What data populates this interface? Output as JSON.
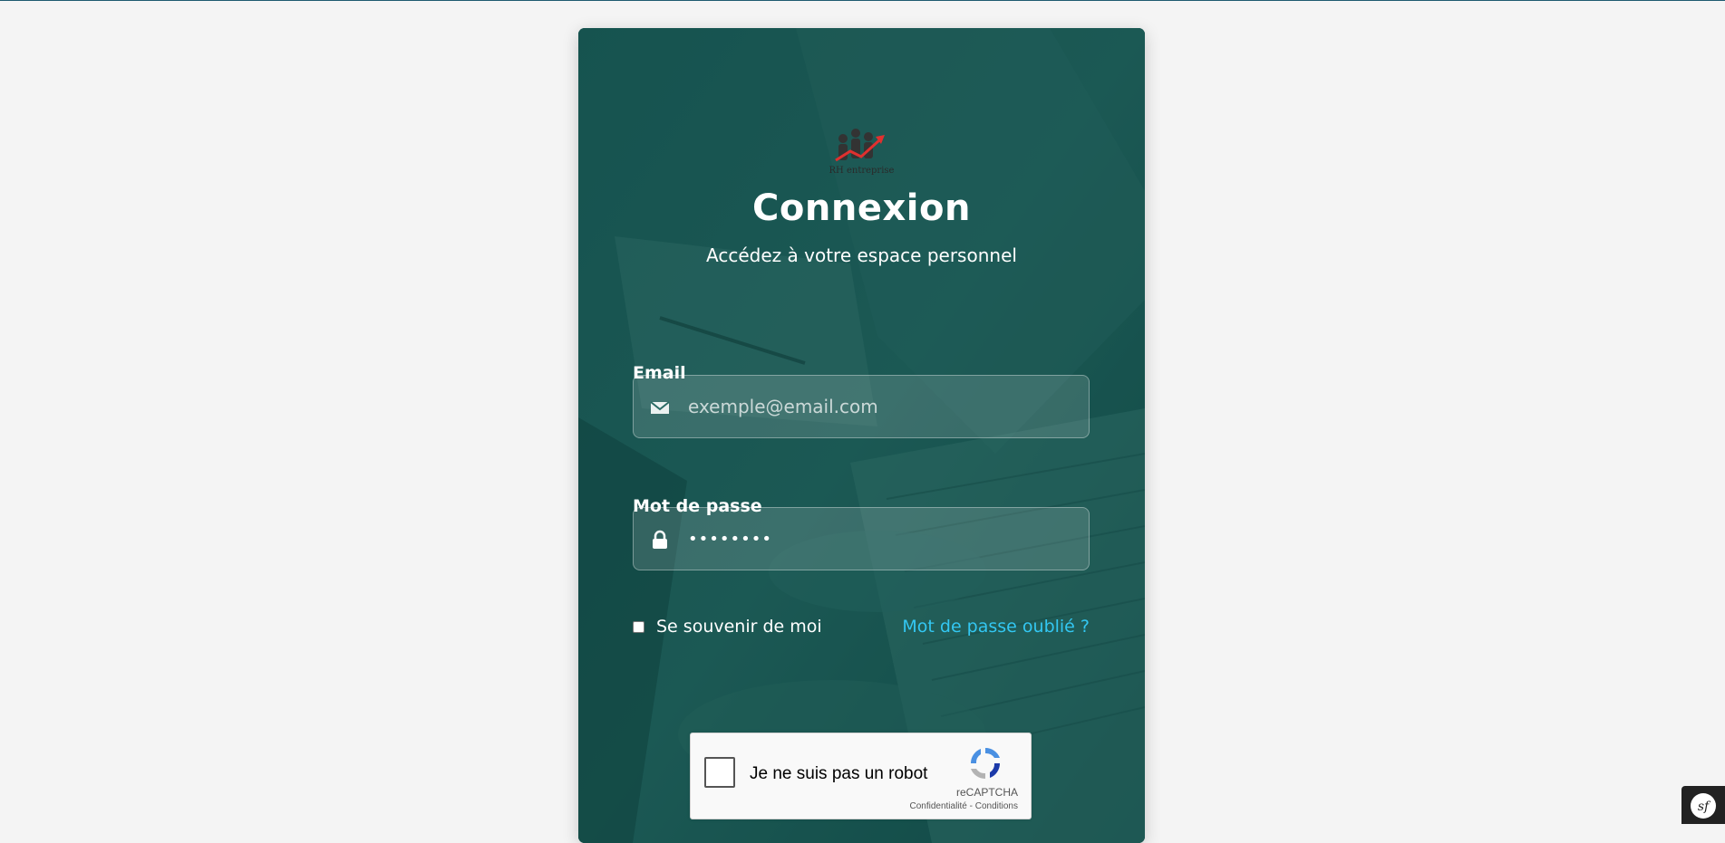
{
  "brand": {
    "logo_text": "RH entreprise"
  },
  "login": {
    "title": "Connexion",
    "subtitle": "Accédez à votre espace personnel",
    "email_label": "Email",
    "email_placeholder": "exemple@email.com",
    "email_icon": "envelope-icon",
    "password_label": "Mot de passe",
    "password_value": "••••••••",
    "password_icon": "lock-icon",
    "remember_label": "Se souvenir de moi",
    "remember_checked": false,
    "forgot_link": "Mot de passe oublié ?"
  },
  "recaptcha": {
    "label": "Je ne suis pas un robot",
    "brand": "reCAPTCHA",
    "links": "Confidentialité - Conditions",
    "checked": false
  },
  "symfony_toolbar": {
    "icon": "symfony-icon",
    "glyph": "sf"
  },
  "colors": {
    "page_background": "#f4f4f4",
    "card_overlay": "#134f4c",
    "link": "#33c7f2",
    "text": "#ffffff"
  }
}
